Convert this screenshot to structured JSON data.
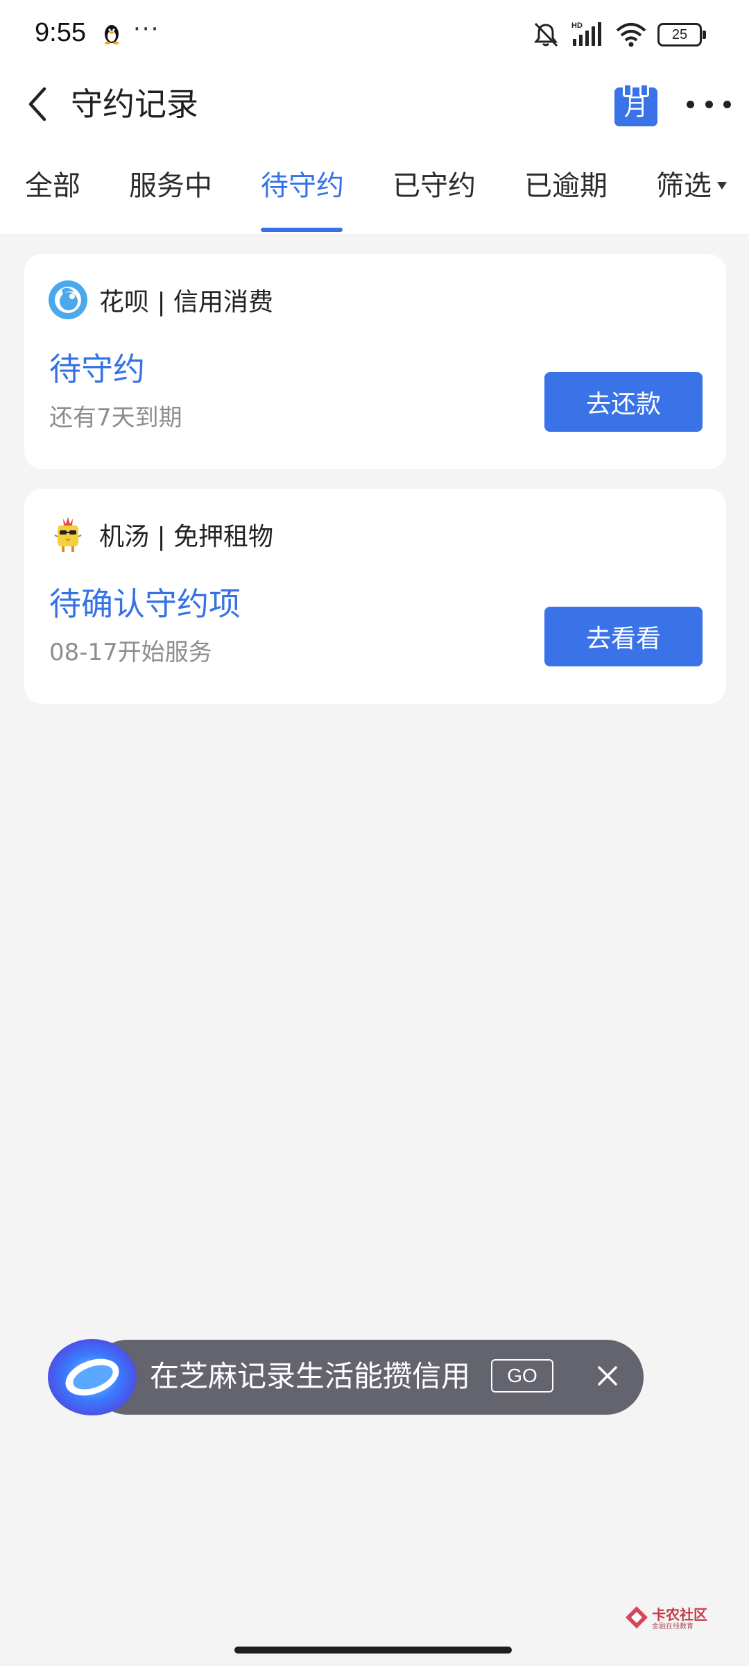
{
  "status_bar": {
    "time": "9:55",
    "dots": "···",
    "battery": "25"
  },
  "header": {
    "title": "守约记录",
    "calendar_label": "月"
  },
  "tabs": [
    {
      "label": "全部",
      "active": false
    },
    {
      "label": "服务中",
      "active": false
    },
    {
      "label": "待守约",
      "active": true
    },
    {
      "label": "已守约",
      "active": false
    },
    {
      "label": "已逾期",
      "active": false
    },
    {
      "label": "筛选",
      "active": false
    }
  ],
  "cards": [
    {
      "source": "花呗 | 信用消费",
      "status": "待守约",
      "detail": "还有7天到期",
      "action": "去还款"
    },
    {
      "source": "机汤 | 免押租物",
      "status": "待确认守约项",
      "detail": "08-17开始服务",
      "action": "去看看"
    }
  ],
  "banner": {
    "text": "在芝麻记录生活能攒信用",
    "go": "GO"
  },
  "watermark": {
    "name": "卡农社区",
    "sub": "金融在线教育"
  },
  "colors": {
    "accent": "#3472e6",
    "button": "#3a73e8",
    "banner_bg": "#63646e",
    "page_bg": "#f4f4f4"
  }
}
